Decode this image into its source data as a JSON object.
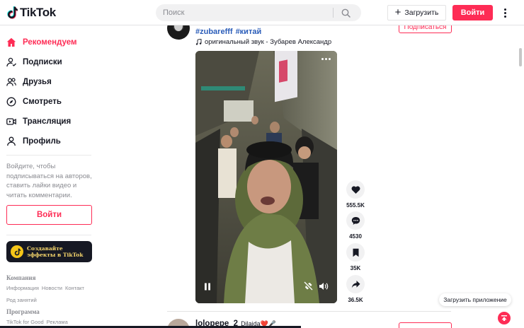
{
  "header": {
    "logo_text": "TikTok",
    "search_placeholder": "Поиск",
    "upload_label": "Загрузить",
    "login_label": "Войти"
  },
  "sidebar": {
    "items": [
      {
        "label": "Рекомендуем",
        "icon": "home-icon",
        "active": true
      },
      {
        "label": "Подписки",
        "icon": "following-icon"
      },
      {
        "label": "Друзья",
        "icon": "friends-icon"
      },
      {
        "label": "Смотреть",
        "icon": "explore-icon"
      },
      {
        "label": "Трансляция",
        "icon": "live-icon"
      },
      {
        "label": "Профиль",
        "icon": "profile-icon"
      }
    ],
    "login_note": "Войдите, чтобы подписываться на авторов, ставить лайки видео и читать комментарии.",
    "login_button": "Войти",
    "effects_label": "Создавайте эффекты в TikTok",
    "footer": {
      "company_heading": "Компания",
      "company_links": [
        "Информация",
        "Новости",
        "Контакт",
        "Род занятий"
      ],
      "program_heading": "Программа",
      "program_links": [
        "TikTok for Good",
        "Реклама"
      ]
    }
  },
  "post": {
    "hashtags": [
      "#zubarefff",
      "#китай"
    ],
    "sound": "оригинальный звук - Зубарев Александр",
    "follow_label": "Подписаться",
    "likes": "555.5K",
    "comments": "4530",
    "saves": "35K",
    "shares": "36.5K"
  },
  "next_post": {
    "author": "lolopepe_2",
    "subtitle": "Dilajda❤️🎤"
  },
  "get_app_label": "Загрузить приложение",
  "colors": {
    "accent": "#fe2c55",
    "hashtag": "#2b5db9",
    "text": "#161823",
    "muted": "#8a8b91"
  }
}
